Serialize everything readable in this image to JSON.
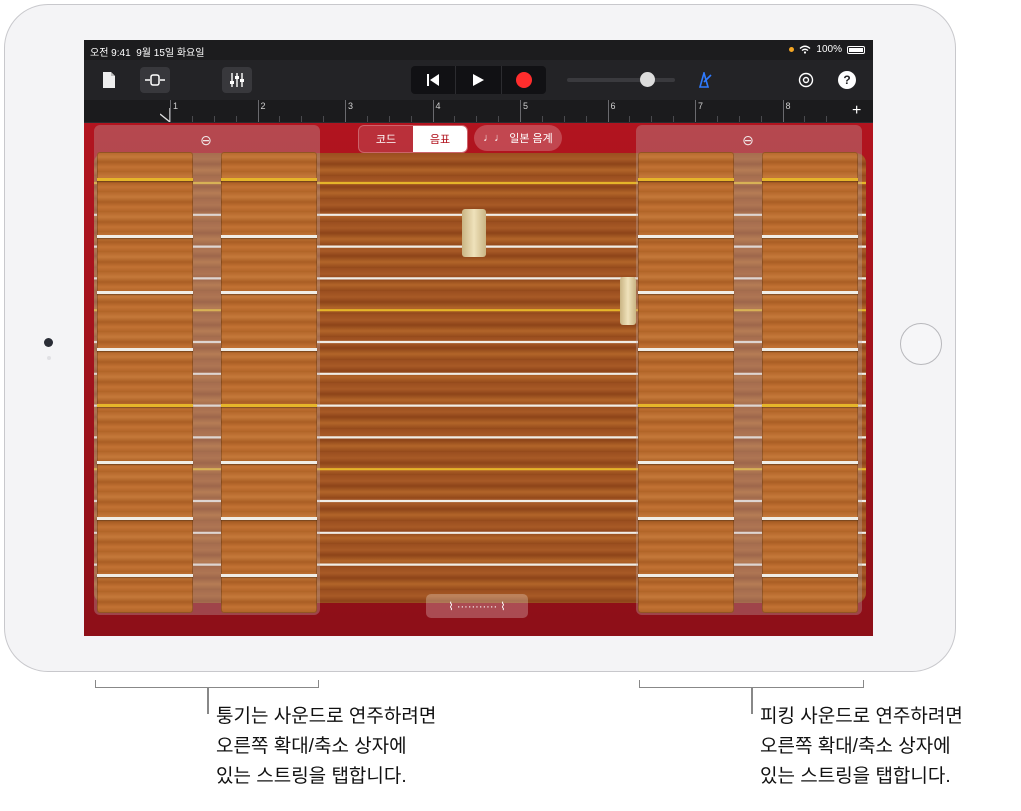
{
  "status": {
    "time": "오전 9:41",
    "date": "9월 15일 화요일",
    "battery": "100%"
  },
  "toolbar": {
    "icons": [
      "document-icon",
      "track-view-icon",
      "mixer-icon",
      "rewind-icon",
      "play-icon",
      "record-icon",
      "metronome-icon",
      "settings-icon",
      "help-icon"
    ],
    "help_label": "?",
    "record_color": "#ff2d2d",
    "metronome_color": "#2f7bff"
  },
  "volume": {
    "level": 0.74
  },
  "ruler": {
    "marks": [
      "1",
      "2",
      "3",
      "4",
      "5",
      "6",
      "7",
      "8"
    ],
    "add_label": "+"
  },
  "instrument": {
    "mode_tabs": [
      {
        "label": "코드",
        "selected": false
      },
      {
        "label": "음표",
        "selected": true
      }
    ],
    "scale_button": "일본 음계",
    "string_count": 13,
    "highlight_strings": [
      0,
      4,
      9
    ],
    "string_color": "#f0ede6",
    "highlight_color": "#e5b52a",
    "stage_color": "#b2141f"
  },
  "callouts": {
    "left": [
      "퉁기는 사운드로 연주하려면",
      "오른쪽 확대/축소 상자에",
      "있는 스트링을 탭합니다."
    ],
    "right": [
      "피킹 사운드로 연주하려면",
      "오른쪽 확대/축소 상자에",
      "있는 스트링을 탭합니다."
    ]
  }
}
